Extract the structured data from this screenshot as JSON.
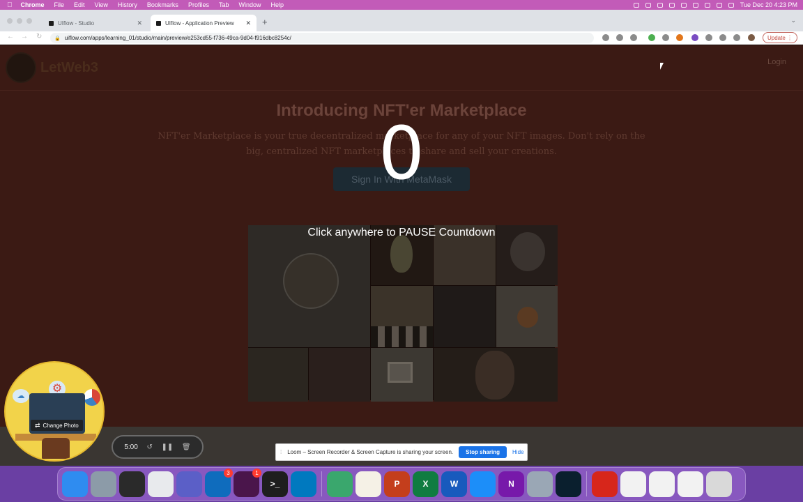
{
  "menubar": {
    "app": "Chrome",
    "items": [
      "File",
      "Edit",
      "View",
      "History",
      "Bookmarks",
      "Profiles",
      "Tab",
      "Window",
      "Help"
    ],
    "clock": "Tue Dec 20  4:23 PM"
  },
  "browser": {
    "tabs": [
      {
        "title": "UIflow - Studio"
      },
      {
        "title": "UIflow - Application Preview"
      }
    ],
    "url": "uiflow.com/apps/learning_01/studio/main/preview/e253cd55-f736-49ca-9d04-f916dbc8254c/",
    "update_label": "Update"
  },
  "page": {
    "logo_text": "LetWeb3",
    "login_label": "Login",
    "headline": "Introducing NFT'er Marketplace",
    "subtext": "NFT'er Marketplace is your true decentralized marketplace for any of your NFT images. Don't rely on the big, centralized NFT marketplaces to share and sell your creations.",
    "signin_label": "Sign In With MetaMask"
  },
  "countdown": {
    "digit": "0",
    "message": "Click anywhere to PAUSE Countdown"
  },
  "loom": {
    "change_photo": "Change Photo",
    "timer": "5:00",
    "share_message": "Loom – Screen Recorder & Screen Capture is sharing your screen.",
    "stop_label": "Stop sharing",
    "hide_label": "Hide"
  },
  "dock": {
    "apps": [
      {
        "name": "finder",
        "color": "#2f8cf0",
        "label": ""
      },
      {
        "name": "launchpad",
        "color": "#8c9ba8",
        "label": ""
      },
      {
        "name": "mission-control",
        "color": "#2a2a2a",
        "label": ""
      },
      {
        "name": "chrome",
        "color": "#e8eaed",
        "label": ""
      },
      {
        "name": "teams",
        "color": "#5b5fc7",
        "label": ""
      },
      {
        "name": "outlook",
        "color": "#0f6cbd",
        "label": "",
        "badge": "3"
      },
      {
        "name": "slack",
        "color": "#4a154b",
        "label": "",
        "badge": "1"
      },
      {
        "name": "terminal",
        "color": "#1e1e1e",
        "label": ">_"
      },
      {
        "name": "trello",
        "color": "#0079bf",
        "label": ""
      },
      {
        "name": "safari-alt",
        "color": "#3aa76d",
        "label": ""
      },
      {
        "name": "notes",
        "color": "#f5f1e6",
        "label": ""
      },
      {
        "name": "powerpoint",
        "color": "#c43e1c",
        "label": "P"
      },
      {
        "name": "excel",
        "color": "#107c41",
        "label": "X"
      },
      {
        "name": "word",
        "color": "#185abd",
        "label": "W"
      },
      {
        "name": "safari",
        "color": "#1c8ef9",
        "label": ""
      },
      {
        "name": "onenote",
        "color": "#7719aa",
        "label": "N"
      },
      {
        "name": "preview",
        "color": "#9aa7b5",
        "label": ""
      },
      {
        "name": "webex",
        "color": "#0a1f2e",
        "label": ""
      },
      {
        "name": "acrobat",
        "color": "#d7261b",
        "label": ""
      },
      {
        "name": "document-1",
        "color": "#f2f2f2",
        "label": ""
      },
      {
        "name": "document-2",
        "color": "#f2f2f2",
        "label": ""
      },
      {
        "name": "document-3",
        "color": "#f2f2f2",
        "label": ""
      },
      {
        "name": "trash",
        "color": "#d9d9d9",
        "label": ""
      }
    ]
  }
}
